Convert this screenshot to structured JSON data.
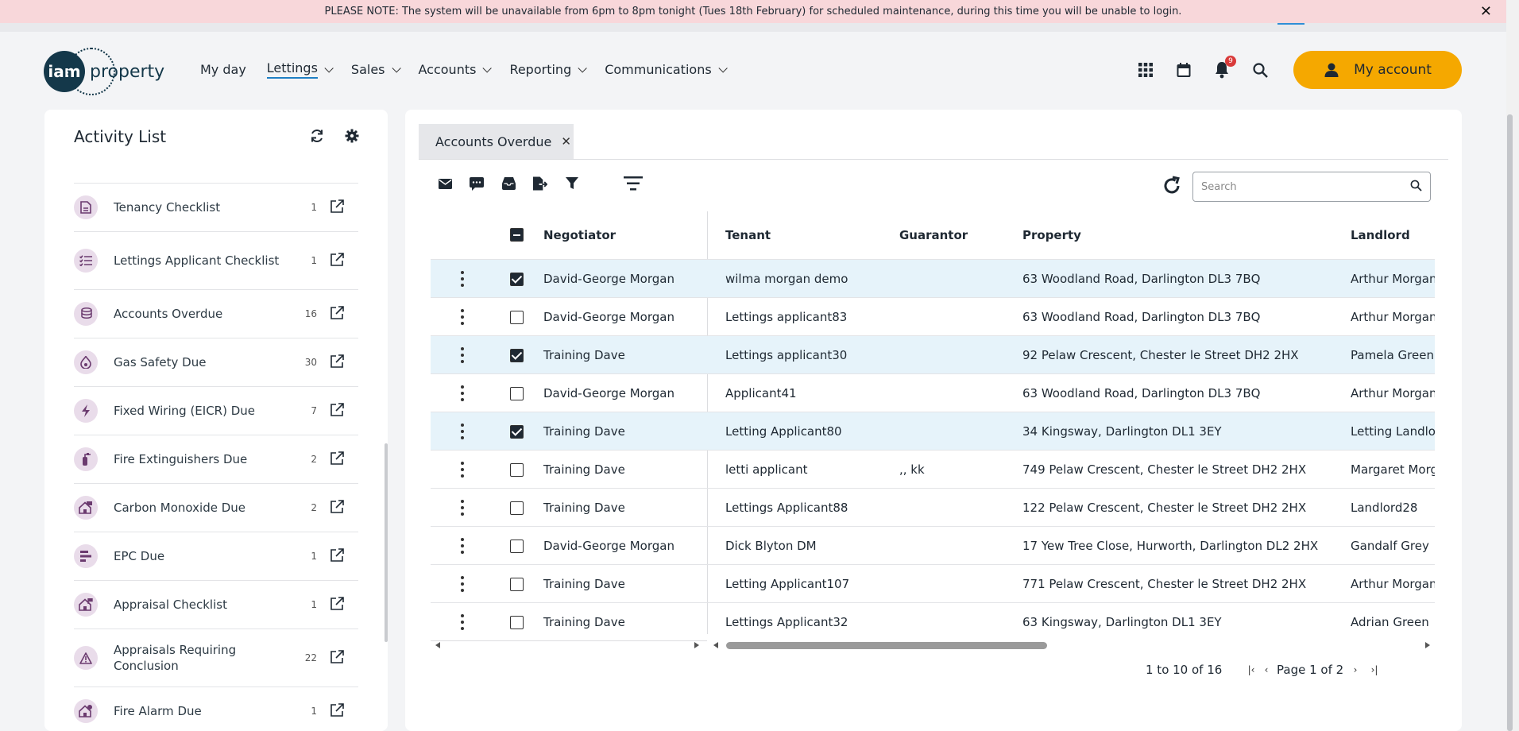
{
  "banner": {
    "prefix": "PLEASE NOTE:",
    "text": " The system will be unavailable from 6pm to 8pm tonight (Tues 18th February) for scheduled maintenance, during this time you will be unable to login.",
    "close": "✕"
  },
  "logo": {
    "mark": "iam",
    "text": "property"
  },
  "nav": [
    {
      "label": "My day",
      "dropdown": false,
      "active": false
    },
    {
      "label": "Lettings",
      "dropdown": true,
      "active": true
    },
    {
      "label": "Sales",
      "dropdown": true,
      "active": false
    },
    {
      "label": "Accounts",
      "dropdown": true,
      "active": false
    },
    {
      "label": "Reporting",
      "dropdown": true,
      "active": false
    },
    {
      "label": "Communications",
      "dropdown": true,
      "active": false
    }
  ],
  "header": {
    "notification_count": "9",
    "account_label": "My account"
  },
  "sidebar": {
    "title": "Activity List",
    "items": [
      {
        "label": "Tenancy Checklist",
        "count": "1",
        "icon": "document-icon"
      },
      {
        "label": "Lettings Applicant Checklist",
        "count": "1",
        "icon": "checklist-icon"
      },
      {
        "label": "Accounts Overdue",
        "count": "16",
        "icon": "coins-icon"
      },
      {
        "label": "Gas Safety Due",
        "count": "30",
        "icon": "flame-icon"
      },
      {
        "label": "Fixed Wiring (EICR) Due",
        "count": "7",
        "icon": "bolt-icon"
      },
      {
        "label": "Fire Extinguishers Due",
        "count": "2",
        "icon": "extinguisher-icon"
      },
      {
        "label": "Carbon Monoxide Due",
        "count": "2",
        "icon": "house-alarm-icon"
      },
      {
        "label": "EPC Due",
        "count": "1",
        "icon": "bars-icon"
      },
      {
        "label": "Appraisal Checklist",
        "count": "1",
        "icon": "house-flag-icon"
      },
      {
        "label": "Appraisals Requiring Conclusion",
        "count": "22",
        "icon": "warning-icon"
      },
      {
        "label": "Fire Alarm Due",
        "count": "1",
        "icon": "house-bell-icon"
      }
    ]
  },
  "main": {
    "tab_label": "Accounts Overdue",
    "search_placeholder": "Search",
    "columns": {
      "negotiator": "Negotiator",
      "tenant": "Tenant",
      "guarantor": "Guarantor",
      "property": "Property",
      "landlord": "Landlord"
    },
    "rows": [
      {
        "selected": true,
        "negotiator": "David-George Morgan",
        "tenant": "wilma morgan demo",
        "guarantor": "",
        "property": "63 Woodland Road, Darlington DL3 7BQ",
        "landlord": "Arthur Morgan"
      },
      {
        "selected": false,
        "negotiator": "David-George Morgan",
        "tenant": "Lettings applicant83",
        "guarantor": "",
        "property": "63 Woodland Road, Darlington DL3 7BQ",
        "landlord": "Arthur Morgan"
      },
      {
        "selected": true,
        "negotiator": "Training Dave",
        "tenant": "Lettings applicant30",
        "guarantor": "",
        "property": "92 Pelaw Crescent, Chester le Street DH2 2HX",
        "landlord": "Pamela Green"
      },
      {
        "selected": false,
        "negotiator": "David-George Morgan",
        "tenant": "Applicant41",
        "guarantor": "",
        "property": "63 Woodland Road, Darlington DL3 7BQ",
        "landlord": "Arthur Morgan"
      },
      {
        "selected": true,
        "negotiator": "Training Dave",
        "tenant": "Letting Applicant80",
        "guarantor": "",
        "property": "34 Kingsway, Darlington DL1 3EY",
        "landlord": "Letting Landlord"
      },
      {
        "selected": false,
        "negotiator": "Training Dave",
        "tenant": "letti applicant",
        "guarantor": ",, kk",
        "property": "749 Pelaw Crescent, Chester le Street DH2 2HX",
        "landlord": "Margaret Morgan"
      },
      {
        "selected": false,
        "negotiator": "Training Dave",
        "tenant": "Lettings Applicant88",
        "guarantor": "",
        "property": "122 Pelaw Crescent, Chester le Street DH2 2HX",
        "landlord": "Landlord28"
      },
      {
        "selected": false,
        "negotiator": "David-George Morgan",
        "tenant": "Dick Blyton DM",
        "guarantor": "",
        "property": "17 Yew Tree Close, Hurworth, Darlington DL2 2HX",
        "landlord": "Gandalf Grey"
      },
      {
        "selected": false,
        "negotiator": "Training Dave",
        "tenant": "Letting Applicant107",
        "guarantor": "",
        "property": "771 Pelaw Crescent, Chester le Street DH2 2HX",
        "landlord": "Arthur Morgan"
      },
      {
        "selected": false,
        "negotiator": "Training Dave",
        "tenant": "Lettings Applicant32",
        "guarantor": "",
        "property": "63 Kingsway, Darlington DL1 3EY",
        "landlord": "Adrian Green"
      }
    ],
    "pager": {
      "range": "1 to 10 of 16",
      "page_label": "Page 1 of 2"
    }
  }
}
